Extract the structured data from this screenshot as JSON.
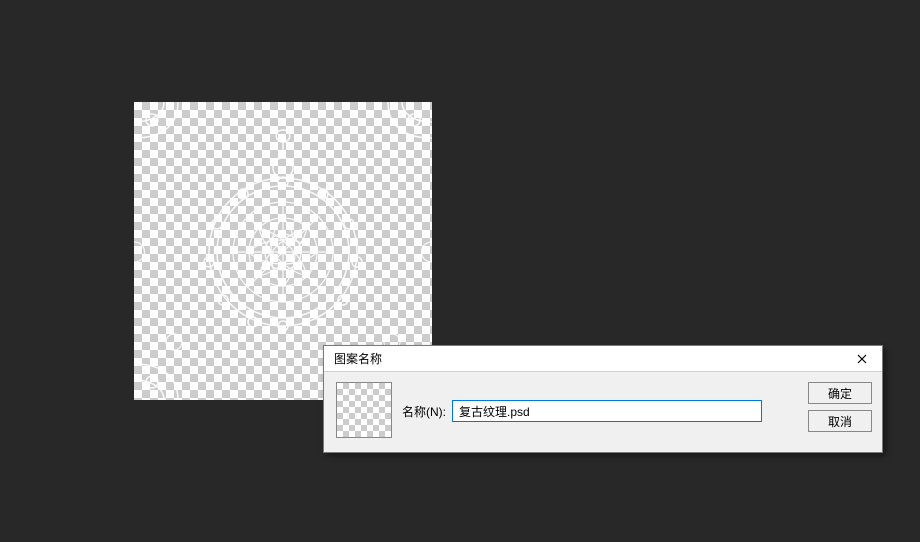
{
  "dialog": {
    "title": "图案名称",
    "name_label": "名称(N):",
    "name_value": "复古纹理.psd",
    "ok_label": "确定",
    "cancel_label": "取消"
  }
}
